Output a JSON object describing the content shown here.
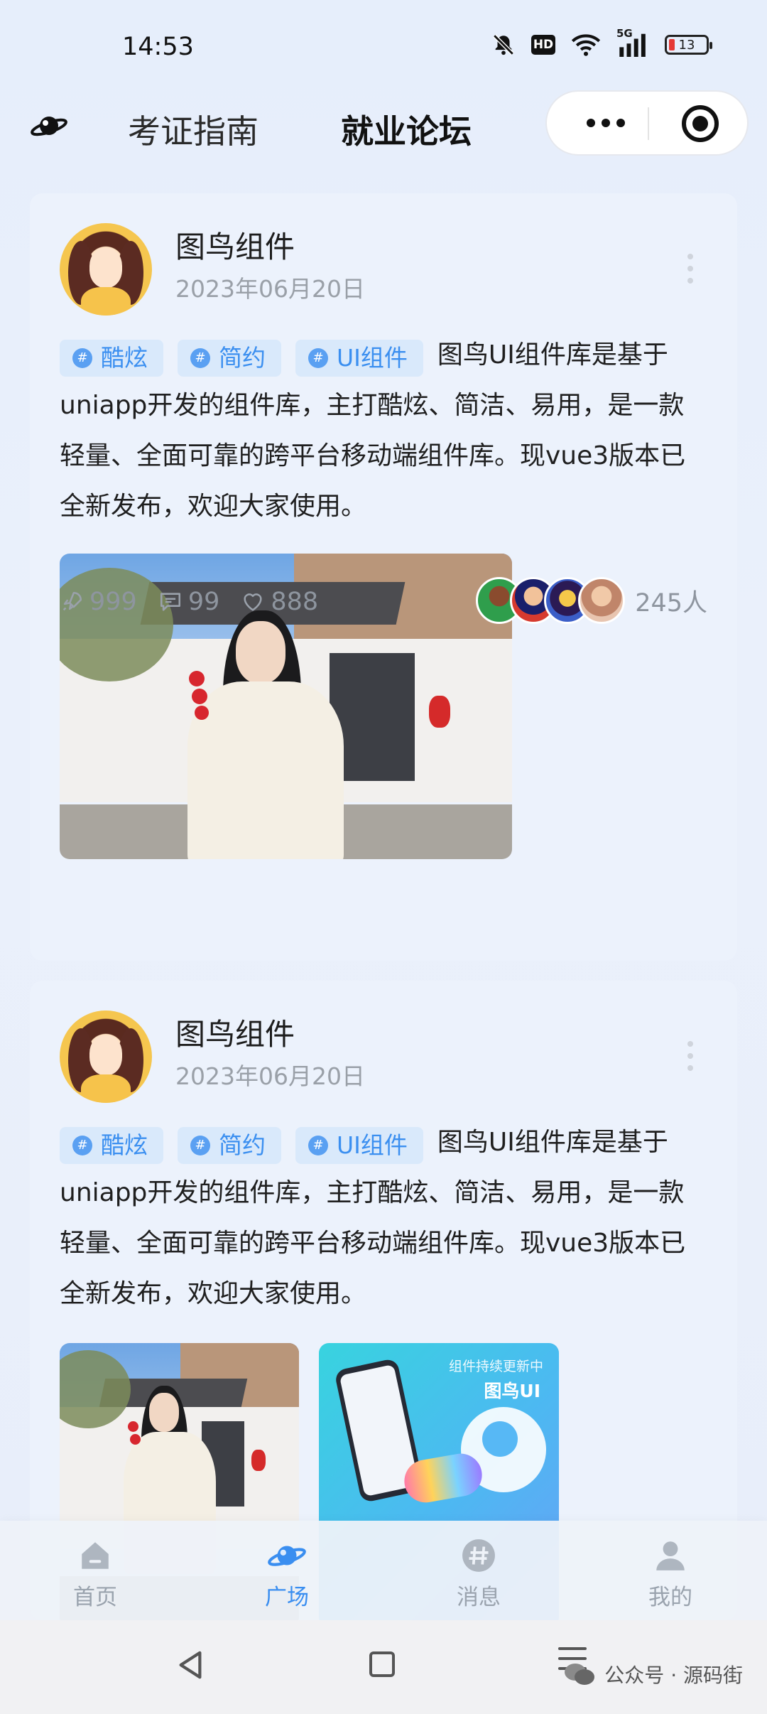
{
  "status_bar": {
    "time": "14:53",
    "network": "5G",
    "battery": "13"
  },
  "header": {
    "tabs": [
      {
        "label": "考证指南",
        "active": false
      },
      {
        "label": "就业论坛",
        "active": true
      }
    ]
  },
  "posts": [
    {
      "author": "图鸟组件",
      "date": "2023年06月20日",
      "tags": [
        "酷炫",
        "简约",
        "UI组件"
      ],
      "text": "图鸟UI组件库是基于uniapp开发的组件库，主打酷炫、简洁、易用，是一款轻量、全面可靠的跨平台移动端组件库。现vue3版本已全新发布，欢迎大家使用。",
      "stats": {
        "views": "999",
        "comments": "99",
        "likes": "888"
      },
      "participants": "245人"
    },
    {
      "author": "图鸟组件",
      "date": "2023年06月20日",
      "tags": [
        "酷炫",
        "简约",
        "UI组件"
      ],
      "text": "图鸟UI组件库是基于uniapp开发的组件库，主打酷炫、简洁、易用，是一款轻量、全面可靠的跨平台移动端组件库。现vue3版本已全新发布，欢迎大家使用。",
      "promo": {
        "line1": "组件持续更新中",
        "line2": "图鸟UI"
      }
    }
  ],
  "tabbar": {
    "items": [
      {
        "label": "首页",
        "icon": "home-icon",
        "active": false
      },
      {
        "label": "广场",
        "icon": "planet-icon",
        "active": true
      },
      {
        "label": "消息",
        "icon": "hashtag-icon",
        "active": false
      },
      {
        "label": "我的",
        "icon": "user-icon",
        "active": false
      }
    ]
  },
  "watermark": "公众号 · 源码街",
  "colors": {
    "accent": "#3a8ef0",
    "tag_bg": "#d9e9fb",
    "inactive": "#9aa3ae"
  }
}
